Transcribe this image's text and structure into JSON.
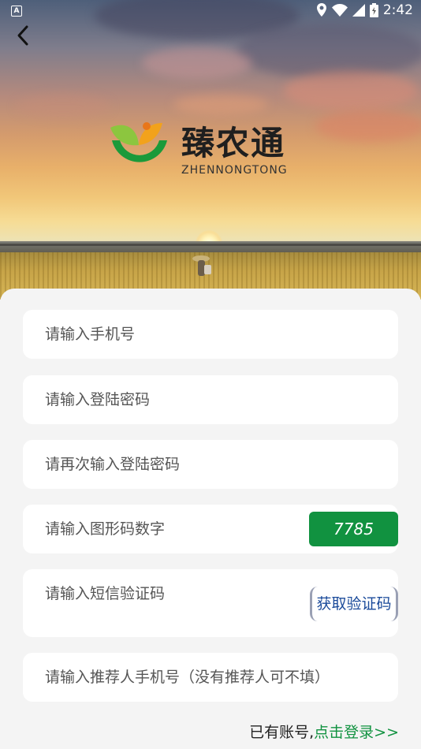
{
  "status_bar": {
    "indicator": "A",
    "time": "2:42",
    "icons": [
      "location-icon",
      "wifi-icon",
      "signal-icon",
      "battery-icon"
    ]
  },
  "header": {
    "back_icon": "chevron-left-icon",
    "logo": {
      "name": "臻农通",
      "subtitle": "ZHENNONGTONG"
    }
  },
  "form": {
    "phone": {
      "placeholder": "请输入手机号",
      "value": ""
    },
    "password": {
      "placeholder": "请输入登陆密码",
      "value": ""
    },
    "confirm_password": {
      "placeholder": "请再次输入登陆密码",
      "value": ""
    },
    "captcha": {
      "placeholder": "请输入图形码数字",
      "value": "",
      "code": "7785"
    },
    "sms": {
      "placeholder": "请输入短信验证码",
      "value": "",
      "button_label": "获取验证码"
    },
    "referrer": {
      "placeholder": "请输入推荐人手机号（没有推荐人可不填）",
      "value": ""
    }
  },
  "footer": {
    "prompt": "已有账号,",
    "login_link": "点击登录>>"
  },
  "colors": {
    "accent_green": "#119240",
    "sms_text_blue": "#1a4a9a",
    "sheet_background": "#f4f4f4"
  }
}
